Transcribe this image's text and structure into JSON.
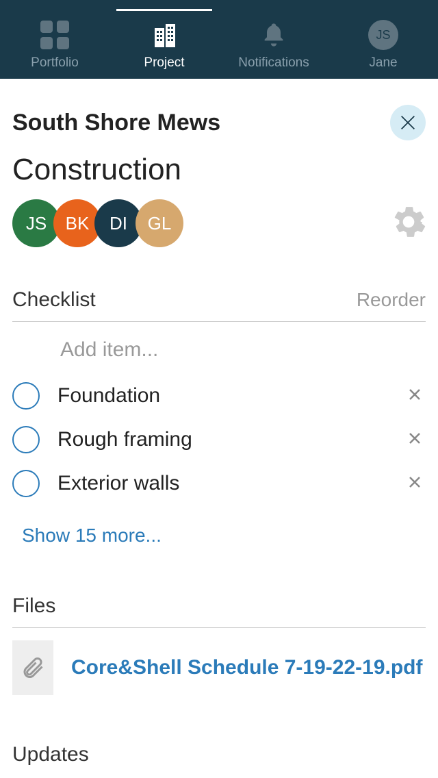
{
  "nav": {
    "items": [
      {
        "label": "Portfolio",
        "iconName": "grid-icon"
      },
      {
        "label": "Project",
        "iconName": "buildings-icon",
        "active": true
      },
      {
        "label": "Notifications",
        "iconName": "bell-icon"
      },
      {
        "label": "Jane",
        "iconName": "avatar-icon",
        "avatarInitials": "JS"
      }
    ]
  },
  "header": {
    "projectTitle": "South Shore Mews",
    "pageTitle": "Construction"
  },
  "people": [
    {
      "initials": "JS",
      "color": "#2a7a44"
    },
    {
      "initials": "BK",
      "color": "#e8631c"
    },
    {
      "initials": "DI",
      "color": "#1a3a4a"
    },
    {
      "initials": "GL",
      "color": "#d6a86e"
    }
  ],
  "checklist": {
    "title": "Checklist",
    "reorderLabel": "Reorder",
    "addPlaceholder": "Add item...",
    "items": [
      {
        "label": "Foundation"
      },
      {
        "label": "Rough framing"
      },
      {
        "label": "Exterior walls"
      }
    ],
    "showMoreLabel": "Show 15 more..."
  },
  "files": {
    "title": "Files",
    "items": [
      {
        "name": "Core&Shell Schedule 7-19-22-19.pdf"
      }
    ]
  },
  "updates": {
    "title": "Updates"
  }
}
